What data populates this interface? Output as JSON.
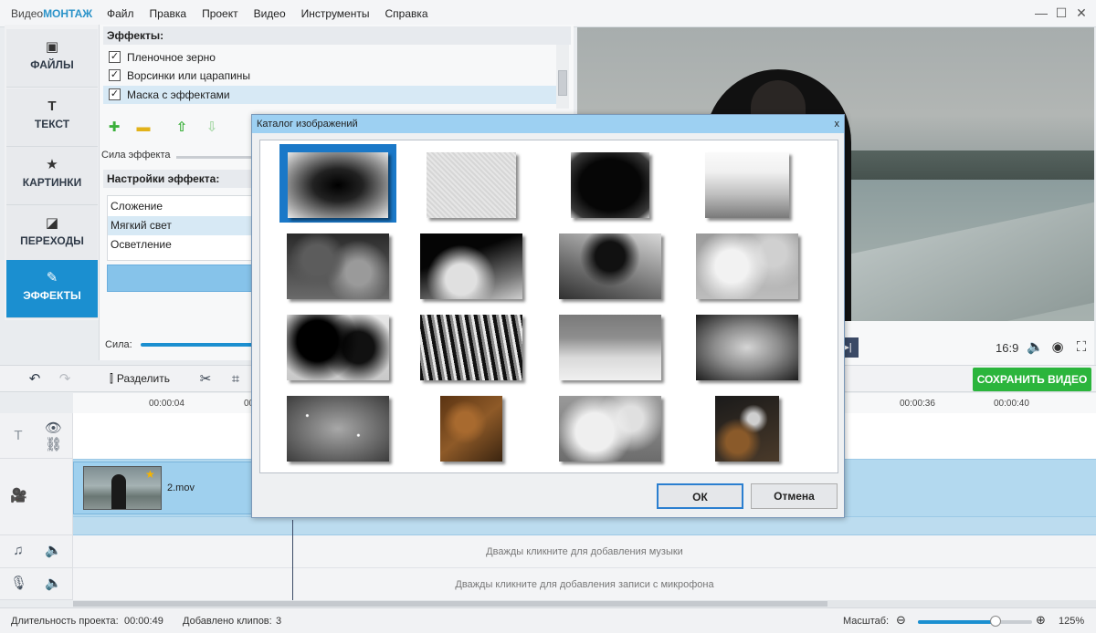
{
  "app": {
    "logo_prefix": "Видео",
    "logo_suffix": "МОНТАЖ",
    "menu": [
      "Файл",
      "Правка",
      "Проект",
      "Видео",
      "Инструменты",
      "Справка"
    ]
  },
  "nav": [
    {
      "label": "ФАЙЛЫ",
      "icon": "image-icon"
    },
    {
      "label": "ТЕКСТ",
      "icon": "text-icon"
    },
    {
      "label": "КАРТИНКИ",
      "icon": "star-icon"
    },
    {
      "label": "ПЕРЕХОДЫ",
      "icon": "transitions-icon"
    },
    {
      "label": "ЭФФЕКТЫ",
      "icon": "effects-icon",
      "active": true
    }
  ],
  "effects": {
    "header": "Эффекты:",
    "items": [
      {
        "label": "Пленочное зерно",
        "checked": true
      },
      {
        "label": "Ворсинки или царапины",
        "checked": true
      },
      {
        "label": "Маска с эффектами",
        "checked": true,
        "selected": true
      }
    ],
    "strength_label": "Сила эффекта",
    "settings_header": "Настройки эффекта:",
    "blend_modes": [
      "Сложение",
      "Мягкий свет",
      "Осветление"
    ],
    "selected_blend": "Мягкий свет",
    "power_label": "Сила:"
  },
  "player": {
    "aspect_ratio": "16:9"
  },
  "toolbar": {
    "split_label": "Разделить",
    "save_label": "СОХРАНИТЬ ВИДЕО"
  },
  "timeline": {
    "ticks": [
      "00:00:04",
      "00:00:08",
      "00:00:36",
      "00:00:40"
    ],
    "clip_name": "2.mov",
    "music_hint": "Дважды кликните для добавления музыки",
    "mic_hint": "Дважды кликните для добавления записи с микрофона"
  },
  "status": {
    "duration_label": "Длительность проекта:",
    "duration_value": "00:00:49",
    "clips_label": "Добавлено клипов:",
    "clips_value": "3",
    "zoom_label": "Масштаб:",
    "zoom_value": "125%",
    "zoom_level": 0.68
  },
  "dialog": {
    "title": "Каталог изображений",
    "close": "x",
    "ok": "ОК",
    "cancel": "Отмена",
    "masks": [
      "mask-vignette-dark",
      "mask-light-grain",
      "mask-black-grunge",
      "mask-fog-bottom",
      "mask-smoke-1",
      "mask-smoke-2",
      "mask-smoke-3",
      "mask-clouds-light",
      "mask-smoke-4",
      "mask-smoke-5",
      "mask-fog-band",
      "mask-vignette-grey",
      "mask-sparkle-grey",
      "mask-rust-texture",
      "mask-fog-soft",
      "mask-grunge-color"
    ]
  }
}
